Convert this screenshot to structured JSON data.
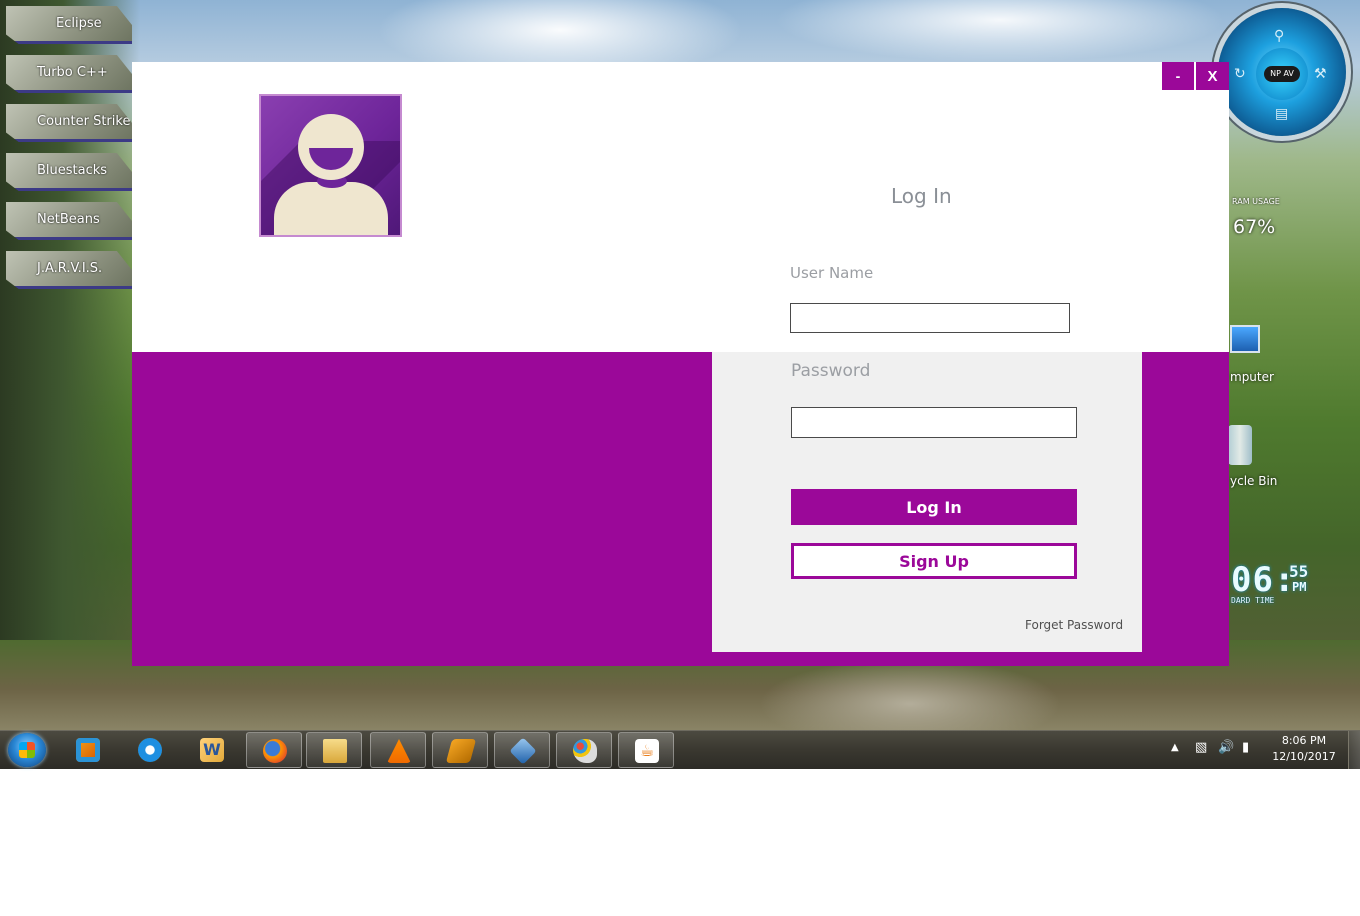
{
  "desktop": {
    "tiles": [
      {
        "label": "Eclipse"
      },
      {
        "label": "Turbo C++"
      },
      {
        "label": "Counter Strike"
      },
      {
        "label": "Bluestacks"
      },
      {
        "label": "NetBeans"
      },
      {
        "label": "J.A.R.V.I.S."
      }
    ],
    "gadgets": {
      "antivirus_badge": "NP AV",
      "ram_label": "RAM USAGE",
      "ram_value": "67%",
      "clock": {
        "hm": "06:",
        "seconds": "55",
        "ampm": "PM",
        "caption": "DARD TIME"
      }
    },
    "icons": {
      "computer": "mputer",
      "recycle_bin": "ycle Bin"
    }
  },
  "app": {
    "window_controls": {
      "minimize": "-",
      "close": "X"
    },
    "title": "Log In",
    "username_label": "User Name",
    "username_value": "",
    "password_label": "Password",
    "password_value": "",
    "login_button": "Log In",
    "signup_button": "Sign Up",
    "forgot_password": "Forget Password",
    "colors": {
      "accent": "#9b0899",
      "panel": "#f0f0f0"
    }
  },
  "taskbar": {
    "items": [
      {
        "name": "media-player",
        "icon": "media-player-icon",
        "active": false
      },
      {
        "name": "internet-explorer",
        "icon": "ie-icon",
        "active": false
      },
      {
        "name": "word",
        "icon": "word-icon",
        "active": false
      },
      {
        "name": "firefox",
        "icon": "firefox-icon",
        "active": true
      },
      {
        "name": "explorer",
        "icon": "folder-icon",
        "active": true
      },
      {
        "name": "vlc",
        "icon": "vlc-icon",
        "active": true
      },
      {
        "name": "winamp",
        "icon": "winamp-icon",
        "active": true
      },
      {
        "name": "virtualbox",
        "icon": "virtualbox-icon",
        "active": true
      },
      {
        "name": "paint",
        "icon": "paint-icon",
        "active": true
      },
      {
        "name": "java",
        "icon": "java-icon",
        "active": true
      }
    ],
    "clock": {
      "time": "8:06 PM",
      "date": "12/10/2017"
    }
  }
}
